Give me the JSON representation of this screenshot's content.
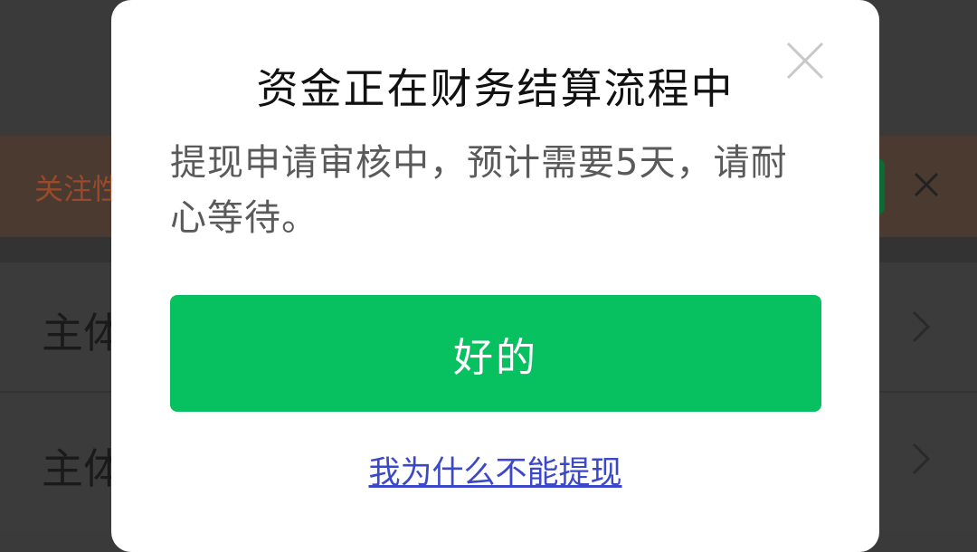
{
  "background": {
    "banner_text": "关注性",
    "rows": [
      {
        "label": "主体"
      },
      {
        "label": "主体"
      }
    ],
    "banner_close_icon": "close-icon",
    "row_chevron_icon": "chevron-right-icon"
  },
  "dialog": {
    "title": "资金正在财务结算流程中",
    "message": "提现申请审核中，预计需要5天，请耐心等待。",
    "confirm_label": "好的",
    "link_label": "我为什么不能提现",
    "close_icon": "close-icon"
  },
  "colors": {
    "primary_green": "#07c160",
    "link_blue": "#3b49c8",
    "overlay": "#3a3a3a"
  }
}
